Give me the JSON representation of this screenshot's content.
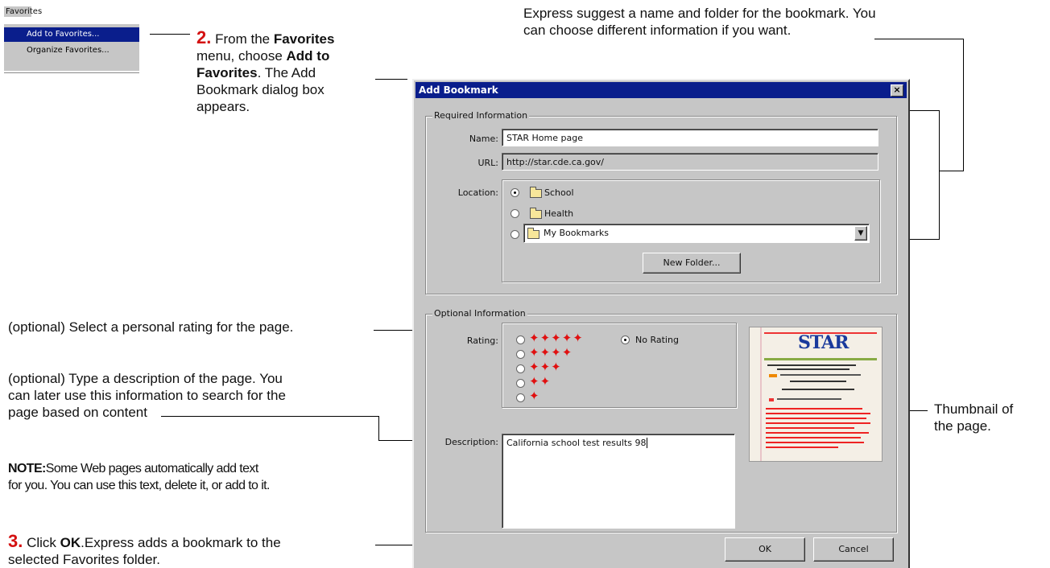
{
  "menu": {
    "title": "Favorites",
    "items": [
      {
        "label": "Add to Favorites..."
      },
      {
        "label": "Organize Favorites..."
      }
    ]
  },
  "callouts": {
    "step2": {
      "num": "2.",
      "t1": "From the ",
      "b1": "Favorites",
      "t2": "menu, choose ",
      "b2": "Add to",
      "b3": "Favorites",
      "t3": ". The Add",
      "t4": "Bookmark dialog box",
      "t5": "appears."
    },
    "suggest": {
      "line1": "Express suggest a name and folder for the bookmark. You",
      "line2": "can choose different information if you want."
    },
    "rating": "(optional) Select a personal rating for the page.",
    "description": {
      "line1": "(optional) Type  a description of the page. You",
      "line2": " can later use  this information to search for the",
      "line3": "page based on content"
    },
    "note": {
      "bold": "NOTE:",
      "line1": "Some Web pages automatically add text",
      "line2": "for you.  You can use this text, delete it, or add to it."
    },
    "step3": {
      "num": "3.",
      "t1": " Click ",
      "b1": "OK",
      "t2": ".Express adds a bookmark to the",
      "t3": "selected Favorites folder."
    },
    "thumbnail": {
      "line1": "Thumbnail of",
      "line2": "the page."
    }
  },
  "dialog": {
    "title": "Add Bookmark",
    "close": "×",
    "required": {
      "legend": "Required Information",
      "name_label": "Name:",
      "name_value": "STAR Home page",
      "url_label": "URL:",
      "url_value": "http://star.cde.ca.gov/",
      "location_label": "Location:",
      "locations": [
        "School",
        "Health",
        "My Bookmarks"
      ],
      "new_folder": "New Folder..."
    },
    "optional": {
      "legend": "Optional Information",
      "rating_label": "Rating:",
      "ratings": [
        "✦✦✦✦✦",
        "✦✦✦✦",
        "✦✦✦",
        "✦✦",
        "✦"
      ],
      "no_rating": "No Rating",
      "description_label": "Description:",
      "description_value": "California school test results 98"
    },
    "ok": "OK",
    "cancel": "Cancel"
  },
  "thumbnail": {
    "logo": "STAR"
  }
}
